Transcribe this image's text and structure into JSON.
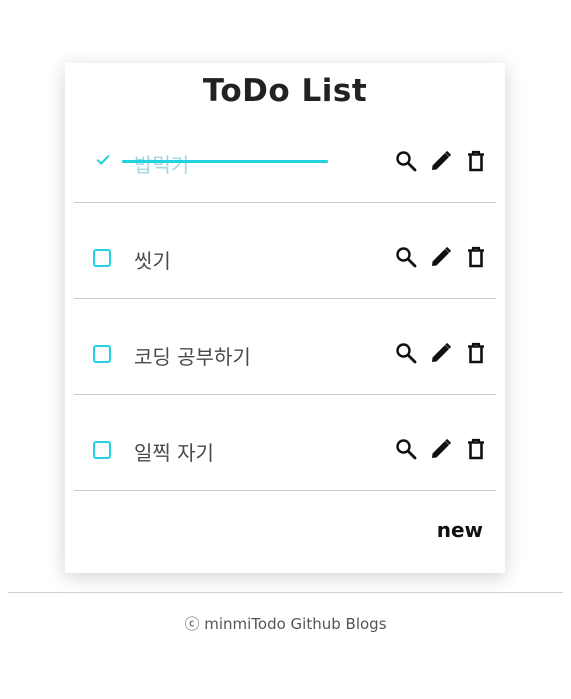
{
  "header": {
    "title": "ToDo List"
  },
  "todos": [
    {
      "text": "밥먹기",
      "done": true
    },
    {
      "text": "씻기",
      "done": false
    },
    {
      "text": "코딩 공부하기",
      "done": false
    },
    {
      "text": "일찍 자기",
      "done": false
    }
  ],
  "icons": {
    "view": "search-icon",
    "edit": "pencil-icon",
    "delete": "trash-icon",
    "done": "check-icon"
  },
  "actions": {
    "new_label": "new"
  },
  "footer": {
    "text": "ⓒ minmiTodo Github Blogs"
  },
  "colors": {
    "accent": "#22d3dd",
    "done_text": "#9cd8dc",
    "divider": "#c9c9c9"
  }
}
